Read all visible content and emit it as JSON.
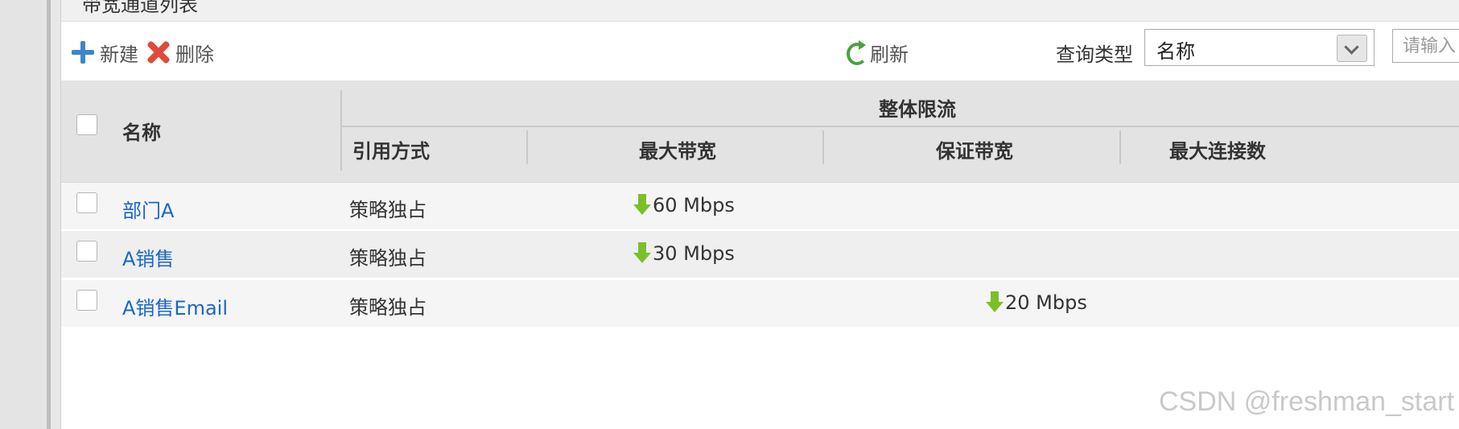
{
  "panel": {
    "title": "带宽通道列表"
  },
  "toolbar": {
    "new_label": "新建",
    "delete_label": "删除",
    "refresh_label": "刷新",
    "query_type_label": "查询类型",
    "query_type_value": "名称",
    "search_placeholder": "请输入"
  },
  "table": {
    "headers": {
      "name": "名称",
      "group": "整体限流",
      "ref_mode": "引用方式",
      "max_bw": "最大带宽",
      "guaranteed_bw": "保证带宽",
      "max_conn": "最大连接数"
    },
    "rows": [
      {
        "name": "部门A",
        "ref_mode": "策略独占",
        "max_bw": "60 Mbps",
        "guaranteed_bw": ""
      },
      {
        "name": "A销售",
        "ref_mode": "策略独占",
        "max_bw": "30 Mbps",
        "guaranteed_bw": ""
      },
      {
        "name": "A销售Email",
        "ref_mode": "策略独占",
        "max_bw": "",
        "guaranteed_bw": "20 Mbps"
      }
    ]
  },
  "icons": {
    "new": "plus-icon",
    "delete": "delete-x-icon",
    "refresh": "refresh-icon",
    "bandwidth": "down-arrow-icon"
  },
  "colors": {
    "link": "#1a66cc",
    "header_bg": "#e3e3e3",
    "arrow": "#7cbf2a"
  },
  "watermark": "CSDN @freshman_start"
}
